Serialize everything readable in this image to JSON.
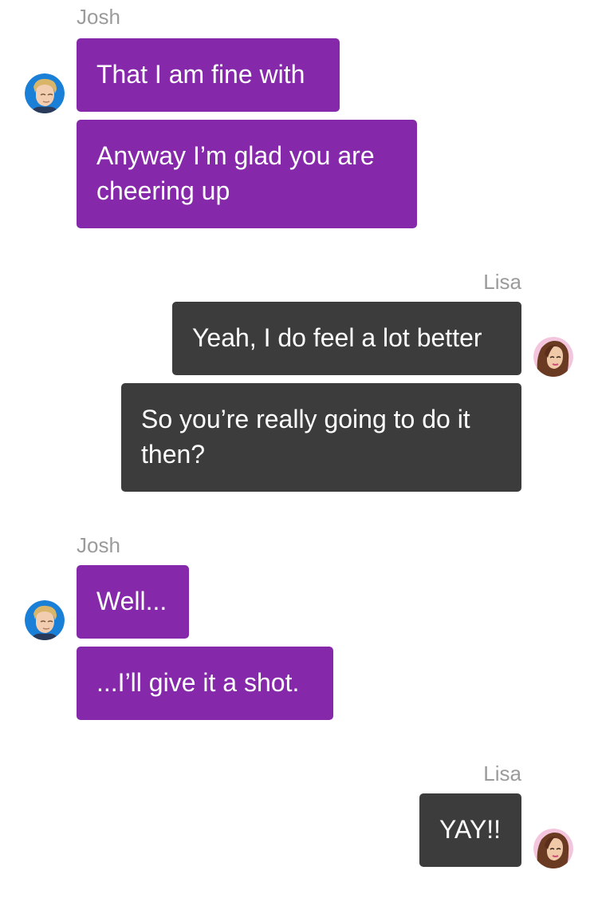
{
  "conversation": {
    "groups": [
      {
        "sender": "Josh",
        "messages": [
          "That I am fine with",
          "Anyway I’m glad you are cheering up"
        ]
      },
      {
        "sender": "Lisa",
        "messages": [
          "Yeah, I do feel a lot better",
          "So you’re really going to do it then?"
        ]
      },
      {
        "sender": "Josh",
        "messages": [
          "Well...",
          "...I’ll give it a shot."
        ]
      },
      {
        "sender": "Lisa",
        "messages": [
          "YAY!!"
        ]
      }
    ]
  },
  "avatars": {
    "josh": "josh-avatar-icon",
    "lisa": "lisa-avatar-icon"
  },
  "colors": {
    "josh_bubble": "#8529aa",
    "lisa_bubble": "#3c3c3c",
    "sender_name": "#9b9b9b"
  }
}
